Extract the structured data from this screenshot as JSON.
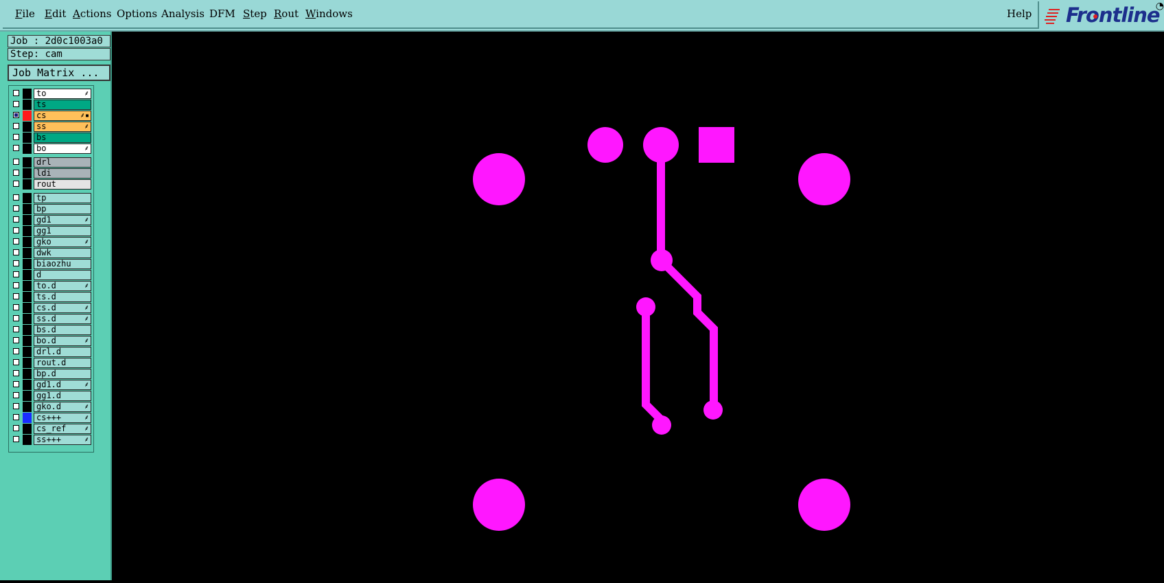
{
  "menubar": {
    "items": [
      {
        "label": "File",
        "ul": "F",
        "rest": "ile"
      },
      {
        "label": "Edit",
        "ul": "E",
        "rest": "dit"
      },
      {
        "label": "Actions",
        "ul": "A",
        "rest": "ctions"
      },
      {
        "label": "Options",
        "ul": "",
        "rest": "Options"
      },
      {
        "label": "Analysis",
        "ul": "",
        "rest": "Analysis"
      },
      {
        "label": "DFM",
        "ul": "",
        "rest": "DFM"
      },
      {
        "label": "Step",
        "ul": "S",
        "rest": "tep"
      },
      {
        "label": "Rout",
        "ul": "R",
        "rest": "out"
      },
      {
        "label": "Windows",
        "ul": "W",
        "rest": "indows"
      }
    ],
    "help": "Help",
    "logo_text": "Frontline"
  },
  "job": {
    "job_label": "Job : 2d0c1003a0",
    "step_label": "Step: cam",
    "matrix_button": "Job Matrix ..."
  },
  "colors": {
    "magenta": "#ff17ff",
    "board_white": "#ffffff",
    "board_green": "#00a884",
    "board_orange": "#ffc05a",
    "drill_gray": "#a9b3b8",
    "rout_light": "#e4e4e4",
    "misc_cyan": "#9fdcd6"
  },
  "layers": [
    {
      "name": "to",
      "bg": "#ffffff",
      "affect": true,
      "color": "",
      "checked": false
    },
    {
      "name": "ts",
      "bg": "#00a884",
      "affect": false,
      "color": "",
      "checked": false
    },
    {
      "name": "cs",
      "bg": "#ffc05a",
      "affect": true,
      "color": "#ff1a1a",
      "checked": true,
      "work": true
    },
    {
      "name": "ss",
      "bg": "#ffc05a",
      "affect": true,
      "color": "",
      "checked": false
    },
    {
      "name": "bs",
      "bg": "#00a884",
      "affect": false,
      "color": "",
      "checked": false
    },
    {
      "name": "bo",
      "bg": "#ffffff",
      "affect": true,
      "color": "",
      "checked": false
    },
    {
      "name": "drl",
      "bg": "#a9b3b8",
      "affect": false,
      "color": "",
      "checked": false,
      "gap": true
    },
    {
      "name": "ldi",
      "bg": "#a9b3b8",
      "affect": false,
      "color": "",
      "checked": false
    },
    {
      "name": "rout",
      "bg": "#e4e4e4",
      "affect": false,
      "color": "",
      "checked": false
    },
    {
      "name": "tp",
      "bg": "#9fdcd6",
      "affect": false,
      "color": "",
      "checked": false,
      "gap": true
    },
    {
      "name": "bp",
      "bg": "#9fdcd6",
      "affect": false,
      "color": "",
      "checked": false
    },
    {
      "name": "gd1",
      "bg": "#9fdcd6",
      "affect": true,
      "color": "",
      "checked": false
    },
    {
      "name": "gg1",
      "bg": "#9fdcd6",
      "affect": false,
      "color": "",
      "checked": false
    },
    {
      "name": "gko",
      "bg": "#9fdcd6",
      "affect": true,
      "color": "",
      "checked": false
    },
    {
      "name": "dwk",
      "bg": "#9fdcd6",
      "affect": false,
      "color": "",
      "checked": false
    },
    {
      "name": "biaozhu",
      "bg": "#9fdcd6",
      "affect": false,
      "color": "",
      "checked": false
    },
    {
      "name": "d",
      "bg": "#9fdcd6",
      "affect": false,
      "color": "",
      "checked": false
    },
    {
      "name": "to.d",
      "bg": "#9fdcd6",
      "affect": true,
      "color": "",
      "checked": false
    },
    {
      "name": "ts.d",
      "bg": "#9fdcd6",
      "affect": false,
      "color": "",
      "checked": false
    },
    {
      "name": "cs.d",
      "bg": "#9fdcd6",
      "affect": true,
      "color": "",
      "checked": false
    },
    {
      "name": "ss.d",
      "bg": "#9fdcd6",
      "affect": true,
      "color": "",
      "checked": false
    },
    {
      "name": "bs.d",
      "bg": "#9fdcd6",
      "affect": false,
      "color": "",
      "checked": false
    },
    {
      "name": "bo.d",
      "bg": "#9fdcd6",
      "affect": true,
      "color": "",
      "checked": false
    },
    {
      "name": "drl.d",
      "bg": "#9fdcd6",
      "affect": false,
      "color": "",
      "checked": false
    },
    {
      "name": "rout.d",
      "bg": "#9fdcd6",
      "affect": false,
      "color": "",
      "checked": false
    },
    {
      "name": "bp.d",
      "bg": "#9fdcd6",
      "affect": false,
      "color": "",
      "checked": false
    },
    {
      "name": "gd1.d",
      "bg": "#9fdcd6",
      "affect": true,
      "color": "",
      "checked": false
    },
    {
      "name": "gg1.d",
      "bg": "#9fdcd6",
      "affect": false,
      "color": "",
      "checked": false
    },
    {
      "name": "gko.d",
      "bg": "#9fdcd6",
      "affect": true,
      "color": "",
      "checked": false
    },
    {
      "name": "cs+++",
      "bg": "#9fdcd6",
      "affect": true,
      "color": "#1a2cff",
      "checked": false
    },
    {
      "name": "cs_ref",
      "bg": "#9fdcd6",
      "affect": true,
      "color": "",
      "checked": false
    },
    {
      "name": "ss+++",
      "bg": "#9fdcd6",
      "affect": true,
      "color": "",
      "checked": false
    }
  ]
}
